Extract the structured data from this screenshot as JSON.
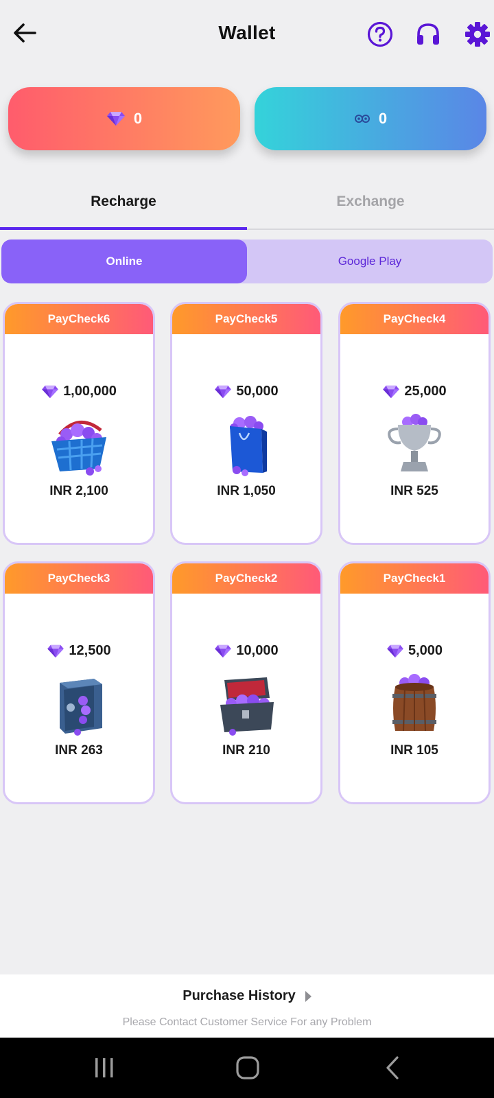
{
  "header": {
    "title": "Wallet"
  },
  "balances": {
    "diamonds": "0",
    "coins": "0"
  },
  "tabs": [
    {
      "label": "Recharge",
      "active": true
    },
    {
      "label": "Exchange",
      "active": false
    }
  ],
  "payment_methods": [
    {
      "label": "Online",
      "active": true
    },
    {
      "label": "Google Play",
      "active": false
    }
  ],
  "packages": [
    {
      "name": "PayCheck6",
      "amount": "1,00,000",
      "price": "INR 2,100",
      "icon": "basket-icon"
    },
    {
      "name": "PayCheck5",
      "amount": "50,000",
      "price": "INR 1,050",
      "icon": "shopping-bag-icon"
    },
    {
      "name": "PayCheck4",
      "amount": "25,000",
      "price": "INR 525",
      "icon": "trophy-icon"
    },
    {
      "name": "PayCheck3",
      "amount": "12,500",
      "price": "INR 263",
      "icon": "safe-icon"
    },
    {
      "name": "PayCheck2",
      "amount": "10,000",
      "price": "INR 210",
      "icon": "treasure-chest-icon"
    },
    {
      "name": "PayCheck1",
      "amount": "5,000",
      "price": "INR 105",
      "icon": "barrel-icon"
    }
  ],
  "footer": {
    "purchase_history": "Purchase History",
    "contact_text": "Please Contact Customer Service For any Problem"
  },
  "colors": {
    "accent": "#5a26ee",
    "card_header_start": "#ff9a2a",
    "card_header_end": "#ff5a78",
    "diamond": "#8a4cf0"
  }
}
